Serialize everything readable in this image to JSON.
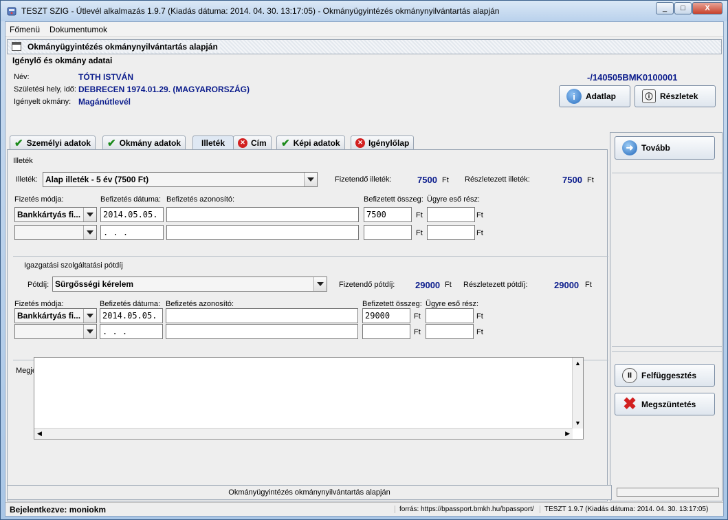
{
  "window": {
    "title": "TESZT SZIG - Útlevél alkalmazás 1.9.7 (Kiadás dátuma: 2014. 04. 30. 13:17:05) - Okmányügyintézés okmánynyilvántartás alapján",
    "minimize": "_",
    "maximize": "□",
    "close": "X"
  },
  "menu": {
    "items": [
      "Főmenü",
      "Dokumentumok"
    ]
  },
  "frame": {
    "title": "Okmányügyintézés okmánynyilvántartás alapján"
  },
  "applicant": {
    "section_title": "Igénylő és okmány adatai",
    "name_label": "Név:",
    "name_value": "TÓTH ISTVÁN",
    "birth_label": "Születési hely, idő:",
    "birth_value": "DEBRECEN 1974.01.29.  (MAGYARORSZÁG)",
    "doc_label": "Igényelt okmány:",
    "doc_value": "Magánútlevél",
    "doc_id": "-/140505BMK0100001",
    "adatlap_button": "Adatlap",
    "reszletek_button": "Részletek"
  },
  "tabs": [
    {
      "label": "Személyi adatok",
      "status": "ok"
    },
    {
      "label": "Okmány adatok",
      "status": "ok"
    },
    {
      "label": "Illeték",
      "status": "active"
    },
    {
      "label": "Cím",
      "status": "error"
    },
    {
      "label": "Képi adatok",
      "status": "ok"
    },
    {
      "label": "Igénylőlap",
      "status": "error"
    }
  ],
  "fee": {
    "section_title": "Illeték",
    "illetek_label": "Illeték:",
    "illetek_value": "Alap illeték - 5 év (7500 Ft)",
    "payable_label": "Fizetendő illeték:",
    "payable_value": "7500",
    "itemized_label": "Részletezett illeték:",
    "itemized_value": "7500",
    "currency": "Ft",
    "col_method": "Fizetés módja:",
    "col_date": "Befizetés dátuma:",
    "col_id": "Befizetés azonosító:",
    "col_amount": "Befizetett összeg:",
    "col_part": "Ügyre eső rész:",
    "row1_method": "Bankkártyás fi...",
    "row1_date": "2014.05.05.",
    "row1_amount": "7500",
    "row2_date": "  .  .  ."
  },
  "surcharge": {
    "section_title": "Igazgatási szolgáltatási pótdíj",
    "potdij_label": "Pótdíj:",
    "potdij_value": "Sürgősségi kérelem",
    "payable_label": "Fizetendő pótdíj:",
    "payable_value": "29000",
    "itemized_label": "Részletezett pótdíj:",
    "itemized_value": "29000",
    "currency": "Ft",
    "col_method": "Fizetés módja:",
    "col_date": "Befizetés dátuma:",
    "col_id": "Befizetés azonosító:",
    "col_amount": "Befizetett összeg:",
    "col_part": "Ügyre eső rész:",
    "row1_method": "Bankkártyás fi...",
    "row1_date": "2014.05.05.",
    "row1_amount": "29000",
    "row2_date": "  .  .  ."
  },
  "notes": {
    "label": "Megjegyzés:"
  },
  "actions": {
    "next": "Tovább",
    "suspend": "Felfüggesztés",
    "cancel": "Megszüntetés"
  },
  "status": {
    "center": "Okmányügyintézés okmánynyilvántartás alapján",
    "user": "Bejelentkezve: moniokm",
    "source": "forrás: https://bpassport.bmkh.hu/bpassport/",
    "version": "TESZT 1.9.7 (Kiadás dátuma: 2014. 04. 30. 13:17:05)"
  },
  "colors": {
    "value_blue": "#0b1c8c",
    "ok_green": "#1a8a1a",
    "error_red": "#d22020"
  }
}
